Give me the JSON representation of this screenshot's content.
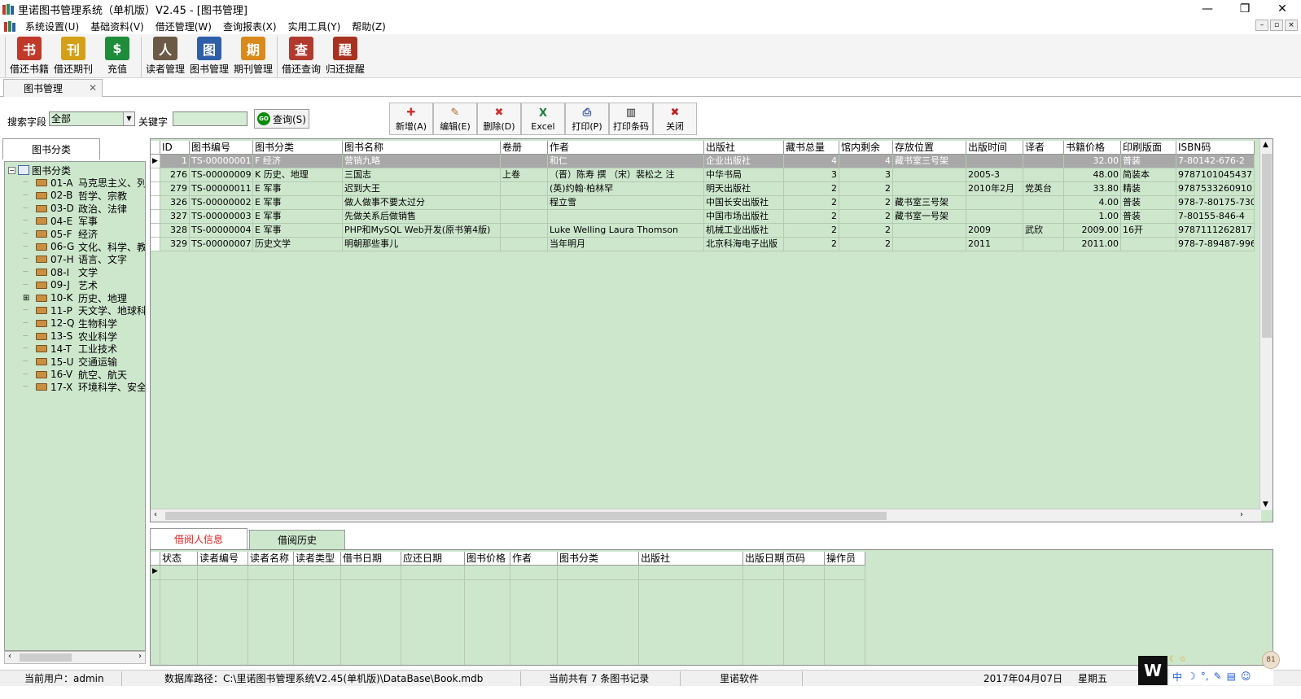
{
  "window": {
    "title": "里诺图书管理系统（单机版）V2.45 - [图书管理]",
    "min_glyph": "—",
    "max_glyph": "❐",
    "close_glyph": "✕"
  },
  "menu": {
    "items": [
      "系统设置(U)",
      "基础资料(V)",
      "借还管理(W)",
      "查询报表(X)",
      "实用工具(Y)",
      "帮助(Z)"
    ],
    "mdi_controls": [
      "–",
      "▫",
      "×"
    ]
  },
  "toolbar": {
    "buttons": [
      {
        "label": "借还书籍",
        "icon": "book-return-icon",
        "color": "#c0392b",
        "glyph": "书"
      },
      {
        "label": "借还期刊",
        "icon": "magazine-icon",
        "color": "#d4a017",
        "glyph": "刊"
      },
      {
        "label": "充值",
        "icon": "dollar-icon",
        "color": "#1e8c3a",
        "glyph": "$"
      },
      {
        "label": "读者管理",
        "icon": "readers-icon",
        "color": "#6b5a45",
        "glyph": "人"
      },
      {
        "label": "图书管理",
        "icon": "books-icon",
        "color": "#2e5fa8",
        "glyph": "图"
      },
      {
        "label": "期刊管理",
        "icon": "journal-icon",
        "color": "#d98a1c",
        "glyph": "期"
      },
      {
        "label": "借还查询",
        "icon": "search-book-icon",
        "color": "#b03a2e",
        "glyph": "查"
      },
      {
        "label": "归还提醒",
        "icon": "reminder-icon",
        "color": "#a83220",
        "glyph": "醒"
      }
    ]
  },
  "doc_tab": {
    "label": "图书管理",
    "close": "✕"
  },
  "search": {
    "field_label": "搜索字段",
    "field_value": "全部",
    "keyword_label": "关键字",
    "keyword_value": "",
    "query_label": "查询(S)",
    "go_glyph": "GO"
  },
  "actions": [
    {
      "label": "新增(A)",
      "icon": "add-icon",
      "glyph": "✚",
      "color": "#d03030"
    },
    {
      "label": "编辑(E)",
      "icon": "edit-icon",
      "glyph": "✎",
      "color": "#b06020"
    },
    {
      "label": "删除(D)",
      "icon": "delete-icon",
      "glyph": "✖",
      "color": "#d03030"
    },
    {
      "label": "Excel",
      "icon": "excel-icon",
      "glyph": "X",
      "color": "#1e7a3a"
    },
    {
      "label": "打印(P)",
      "icon": "print-icon",
      "glyph": "⎙",
      "color": "#3050a0"
    },
    {
      "label": "打印条码",
      "icon": "barcode-icon",
      "glyph": "▥",
      "color": "#202020"
    },
    {
      "label": "关闭",
      "icon": "close-icon",
      "glyph": "✖",
      "color": "#c02020"
    }
  ],
  "tree": {
    "tab_label": "图书分类",
    "root": "图书分类",
    "items": [
      {
        "code": "01-A",
        "name": "马克思主义、列"
      },
      {
        "code": "02-B",
        "name": "哲学、宗教"
      },
      {
        "code": "03-D",
        "name": "政治、法律"
      },
      {
        "code": "04-E",
        "name": "军事"
      },
      {
        "code": "05-F",
        "name": "经济"
      },
      {
        "code": "06-G",
        "name": "文化、科学、教"
      },
      {
        "code": "07-H",
        "name": "语言、文字"
      },
      {
        "code": "08-I",
        "name": "文学"
      },
      {
        "code": "09-J",
        "name": "艺术"
      },
      {
        "code": "10-K",
        "name": "历史、地理",
        "expandable": true
      },
      {
        "code": "11-P",
        "name": "天文学、地球科"
      },
      {
        "code": "12-Q",
        "name": "生物科学"
      },
      {
        "code": "13-S",
        "name": "农业科学"
      },
      {
        "code": "14-T",
        "name": "工业技术"
      },
      {
        "code": "15-U",
        "name": "交通运输"
      },
      {
        "code": "16-V",
        "name": "航空、航天"
      },
      {
        "code": "17-X",
        "name": "环境科学、安全"
      }
    ]
  },
  "grid": {
    "columns": [
      "ID",
      "图书编号",
      "图书分类",
      "图书名称",
      "卷册",
      "作者",
      "出版社",
      "藏书总量",
      "馆内剩余",
      "存放位置",
      "出版时间",
      "译者",
      "书籍价格",
      "印刷版面",
      "ISBN码"
    ],
    "rows": [
      [
        "1",
        "TS-00000001",
        "F  经济",
        "营销九略",
        "",
        "和仁",
        "企业出版社",
        "4",
        "4",
        "藏书室三号架",
        "",
        "",
        "32.00",
        "普装",
        "7-80142-676-2"
      ],
      [
        "276",
        "TS-00000009",
        "K  历史、地理",
        "三国志",
        "上卷",
        "（晋）陈寿  撰 （宋）裴松之 注",
        "中华书局",
        "3",
        "3",
        "",
        "2005-3",
        "",
        "48.00",
        "简装本",
        "9787101045437"
      ],
      [
        "279",
        "TS-00000011",
        "E  军事",
        "迟到大王",
        "",
        "(英)约翰·柏林罕",
        "明天出版社",
        "2",
        "2",
        "",
        "2010年2月",
        "党英台",
        "33.80",
        "精装",
        "9787533260910"
      ],
      [
        "326",
        "TS-00000002",
        "E  军事",
        "做人做事不要太过分",
        "",
        "程立雪",
        "中国长安出版社",
        "2",
        "2",
        "藏书室三号架",
        "",
        "",
        "4.00",
        "普装",
        "978-7-80175-730-"
      ],
      [
        "327",
        "TS-00000003",
        "E  军事",
        "先做关系后做销售",
        "",
        "",
        "中国市场出版社",
        "2",
        "2",
        "藏书室一号架",
        "",
        "",
        "1.00",
        "普装",
        "7-80155-846-4"
      ],
      [
        "328",
        "TS-00000004",
        "E  军事",
        "PHP和MySQL Web开发(原书第4版)",
        "",
        "Luke Welling Laura Thomson",
        "机械工业出版社",
        "2",
        "2",
        "",
        "2009",
        "武欣",
        "2009.00",
        "16开",
        "9787111262817"
      ],
      [
        "329",
        "TS-00000007",
        "历史文学",
        "明朝那些事儿",
        "",
        "当年明月",
        "北京科海电子出版",
        "2",
        "2",
        "",
        "2011",
        "",
        "2011.00",
        "",
        "978-7-89487-996-"
      ]
    ]
  },
  "bottom_tabs": {
    "active": "借阅人信息",
    "inactive": "借阅历史"
  },
  "bottom_grid": {
    "columns": [
      "状态",
      "读者编号",
      "读者名称",
      "读者类型",
      "借书日期",
      "应还日期",
      "图书价格",
      "作者",
      "图书分类",
      "出版社",
      "出版日期",
      "页码",
      "操作员"
    ]
  },
  "status": {
    "user": "当前用户：admin",
    "db_path": "数据库路径：C:\\里诺图书管理系统V2.45(单机版)\\DataBase\\Book.mdb",
    "record_count": "当前共有 7 条图书记录",
    "vendor": "里诺软件",
    "date": "2017年04月07日",
    "weekday": "星期五"
  },
  "ime": {
    "logo": "W",
    "items": [
      "中",
      "☽",
      "°,",
      "✎",
      "▤",
      "☺"
    ],
    "top": "☾ ☆",
    "circle": "81"
  }
}
